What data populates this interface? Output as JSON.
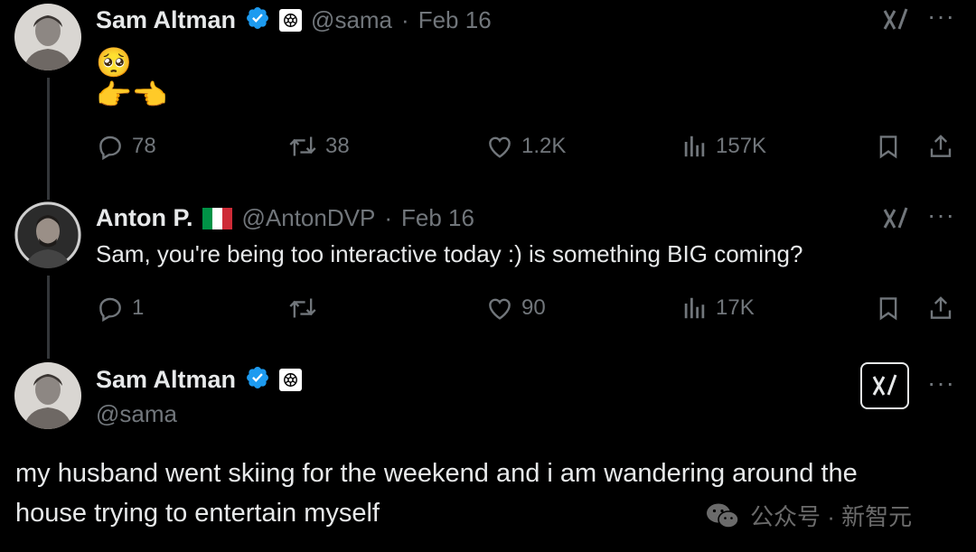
{
  "tweet1": {
    "name": "Sam Altman",
    "handle": "@sama",
    "separator": "·",
    "date": "Feb 16",
    "emoji_line1": "🥺",
    "emoji_line2": "👉👈",
    "stats": {
      "replies": "78",
      "reposts": "38",
      "likes": "1.2K",
      "views": "157K"
    }
  },
  "tweet2": {
    "name": "Anton P.",
    "flag": "🇮🇹",
    "handle": "@AntonDVP",
    "separator": "·",
    "date": "Feb 16",
    "text": "Sam, you're being too interactive today :) is something BIG coming?",
    "stats": {
      "replies": "1",
      "reposts": "",
      "likes": "90",
      "views": "17K"
    }
  },
  "tweet3": {
    "name": "Sam Altman",
    "handle": "@sama",
    "text_line1": "my husband went skiing for the weekend and i am wandering around the",
    "text_line2": "house trying to entertain myself"
  },
  "more_label": "···",
  "watermark": {
    "text": "公众号 · 新智元",
    "icon": "wechat-icon"
  },
  "colors": {
    "background": "#000000",
    "text": "#e7e9ea",
    "muted": "#71767b",
    "verified": "#1d9bf0"
  }
}
